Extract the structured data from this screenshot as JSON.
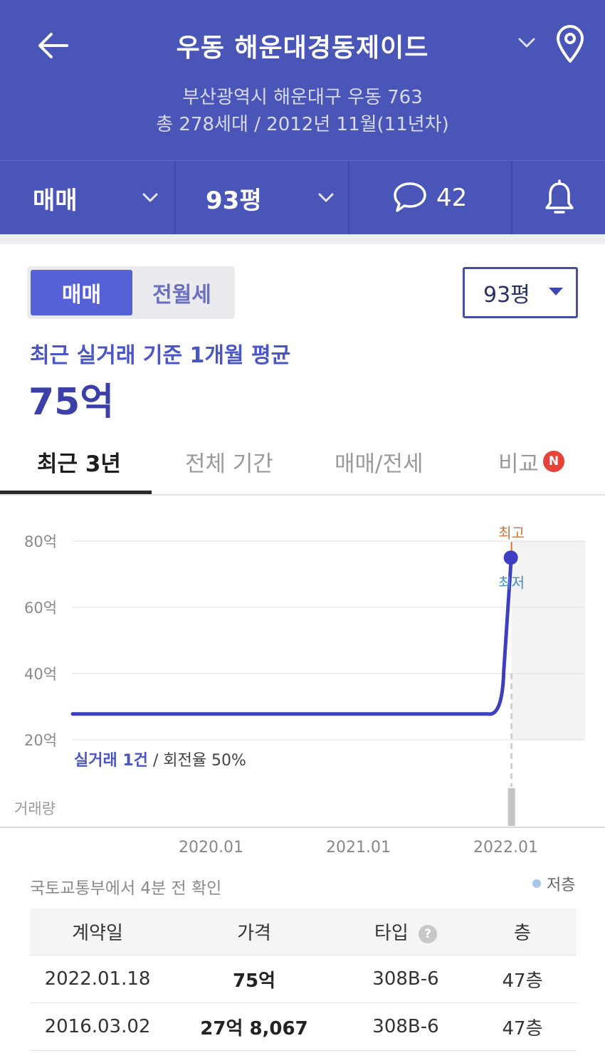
{
  "header": {
    "title": "우동 해운대경동제이드",
    "address": "부산광역시 해운대구 우동 763",
    "summary": "총 278세대 / 2012년 11월(11년차)",
    "deal_type": "매매",
    "size": "93평",
    "comment_count": "42",
    "colors": {
      "background": "#4a55b8"
    }
  },
  "toggle": {
    "active": "매매",
    "inactive": "전월세"
  },
  "size_select": {
    "value": "93평"
  },
  "average": {
    "label": "최근 실거래 기준 1개월 평균",
    "value": "75억"
  },
  "period_tabs": [
    {
      "label": "최근 3년",
      "active": true
    },
    {
      "label": "전체 기간",
      "active": false
    },
    {
      "label": "매매/전세",
      "active": false
    },
    {
      "label": "비교",
      "active": false,
      "badge": "N"
    }
  ],
  "chart_data": {
    "type": "line",
    "y_ticks": [
      "80억",
      "60억",
      "40억",
      "20억"
    ],
    "ylim": [
      20,
      80
    ],
    "x_ticks": [
      "2020.01",
      "2021.01",
      "2022.01"
    ],
    "series": [
      {
        "points": [
          {
            "x": "2019.03",
            "y": 27.8
          },
          {
            "x": "2021.12",
            "y": 27.8
          },
          {
            "x": "2022.01.18",
            "y": 75
          }
        ]
      }
    ],
    "annotations": {
      "high": "최고",
      "low": "최저"
    },
    "volume": [
      {
        "x": "2022.01",
        "count": 1
      }
    ],
    "colors": {
      "line": "#3d3fc0",
      "high": "#d2733a",
      "low": "#3e8ec9"
    },
    "grid": true
  },
  "chart_meta": {
    "trades_label": "실거래 1건",
    "turnover": "/ 회전율 50%",
    "volume_label": "거래량"
  },
  "source": {
    "text": "국토교통부에서 4분 전 확인",
    "legend": "저층"
  },
  "table": {
    "headers": [
      "계약일",
      "가격",
      "타입",
      "층"
    ],
    "rows": [
      {
        "date": "2022.01.18",
        "price": "75억",
        "type": "308B-6",
        "floor": "47층"
      },
      {
        "date": "2016.03.02",
        "price": "27억 8,067",
        "type": "308B-6",
        "floor": "47층"
      }
    ]
  }
}
